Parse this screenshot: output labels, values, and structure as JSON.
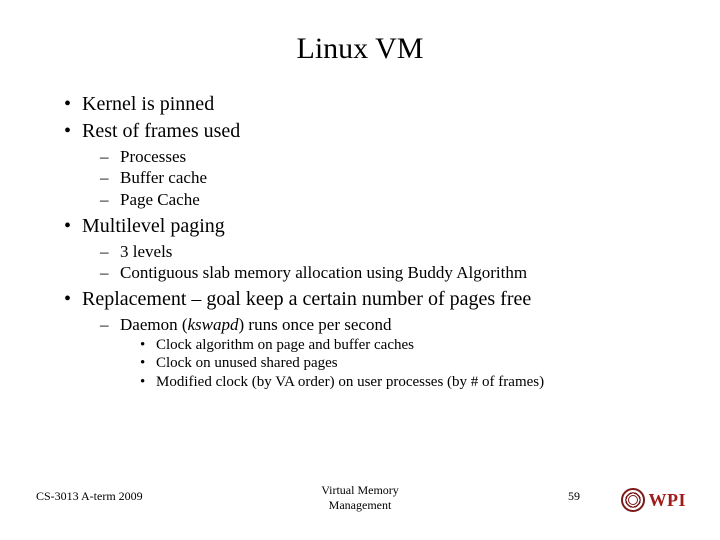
{
  "title": "Linux VM",
  "bullets": {
    "b1_1": "Kernel is pinned",
    "b1_2": "Rest of frames used",
    "b2_1": "Processes",
    "b2_2": "Buffer cache",
    "b2_3": "Page Cache",
    "b1_3": "Multilevel paging",
    "b2_4": "3 levels",
    "b2_5": "Contiguous slab memory allocation using Buddy Algorithm",
    "b1_4": "Replacement – goal keep a certain number of pages free",
    "b2_6_pre": "Daemon (",
    "b2_6_em": "kswapd",
    "b2_6_post": ") runs once per second",
    "b3_1": "Clock algorithm on page and buffer caches",
    "b3_2": "Clock on unused shared pages",
    "b3_3": "Modified clock (by VA order) on user processes (by # of frames)"
  },
  "footer": {
    "left": "CS-3013 A-term 2009",
    "center_line1": "Virtual Memory",
    "center_line2": "Management",
    "page": "59",
    "logo_text": "WPI"
  }
}
